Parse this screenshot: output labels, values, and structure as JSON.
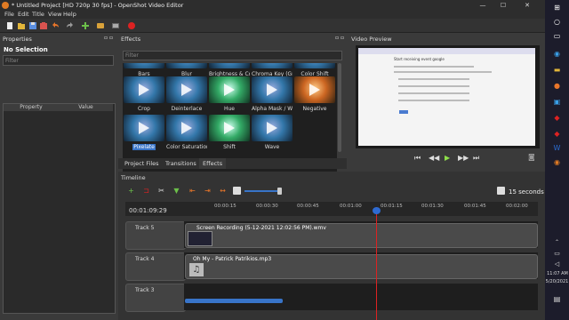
{
  "window": {
    "title": "* Untitled Project [HD 720p 30 fps] - OpenShot Video Editor",
    "min_symbol": "—",
    "max_symbol": "☐",
    "close_symbol": "✕"
  },
  "menu": [
    "File",
    "Edit",
    "Title",
    "View",
    "Help"
  ],
  "toolbar": {
    "icons": [
      "new-project-icon",
      "open-project-icon",
      "save-project-icon",
      "import-files-icon",
      "undo-icon",
      "redo-icon",
      "add-track-icon",
      "profile-icon",
      "fullscreen-icon",
      "export-icon"
    ]
  },
  "properties": {
    "title": "Properties",
    "selection": "No Selection",
    "filter_placeholder": "Filter",
    "col_property": "Property",
    "col_value": "Value"
  },
  "effects": {
    "title": "Effects",
    "filter_placeholder": "Filter",
    "row1": [
      "Bars",
      "Blur",
      "Brightness & Co...",
      "Chroma Key (Gr...",
      "Color Shift"
    ],
    "row2": [
      "Crop",
      "Deinterlace",
      "Hue",
      "Alpha Mask / W...",
      "Negative"
    ],
    "row3": [
      "Pixelate",
      "Color Saturation",
      "Shift",
      "Wave"
    ]
  },
  "tabs": [
    "Project Files",
    "Transitions",
    "Effects"
  ],
  "active_tab": "Effects",
  "video_preview": {
    "title": "Video Preview",
    "page_heading": "Start receiving event google"
  },
  "timeline": {
    "title": "Timeline",
    "zoom_label": "15 seconds",
    "current_time": "00:01:09:29",
    "ticks": [
      "00:00:15",
      "00:00:30",
      "00:00:45",
      "00:01:00",
      "00:01:15",
      "00:01:30",
      "00:01:45",
      "00:02:00"
    ],
    "tracks": [
      {
        "name": "Track 5",
        "clip": "Screen Recording (5-12-2021 12:02:56 PM).wmv"
      },
      {
        "name": "Track 4",
        "clip": "Oh My - Patrick Patrikios.mp3"
      },
      {
        "name": "Track 3",
        "clip": ""
      }
    ]
  },
  "taskbar": {
    "time": "11:07 AM",
    "date": "5/20/2021"
  },
  "colors": {
    "accent": "#3874c8",
    "playhead": "#d22222",
    "background": "#2b2b2b"
  }
}
